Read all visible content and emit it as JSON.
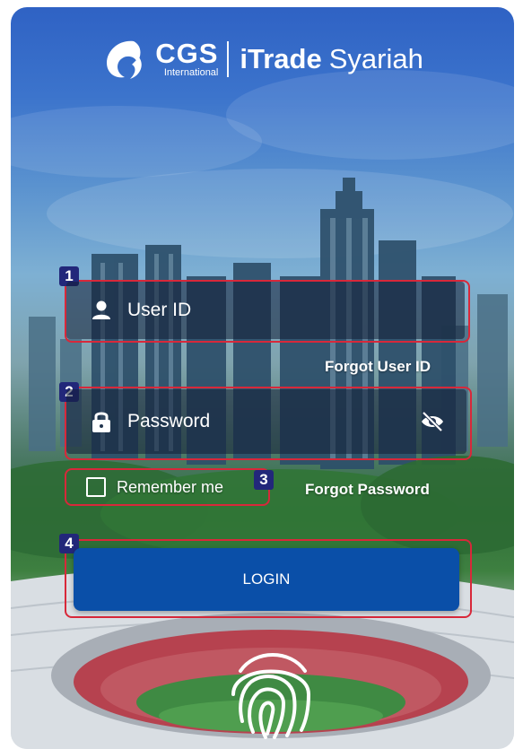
{
  "brand": {
    "company": "CGS",
    "company_sub": "International",
    "product_bold": "iTrade",
    "product_light": "Syariah"
  },
  "login_form": {
    "user_id_placeholder": "User ID",
    "password_placeholder": "Password",
    "forgot_user_id": "Forgot User ID",
    "remember_me": "Remember me",
    "forgot_password": "Forgot Password",
    "login_button": "LOGIN"
  },
  "annotations": {
    "badge_1": "1",
    "badge_2": "2",
    "badge_3": "3",
    "badge_4": "4",
    "highlight_color": "#d8283a",
    "badge_color": "#22277a"
  },
  "icons": {
    "user": "person-icon",
    "password": "lock-icon",
    "visibility": "eye-off-icon",
    "biometric": "fingerprint-icon"
  },
  "colors": {
    "primary_button": "#0a4fa8",
    "text": "#ffffff"
  }
}
